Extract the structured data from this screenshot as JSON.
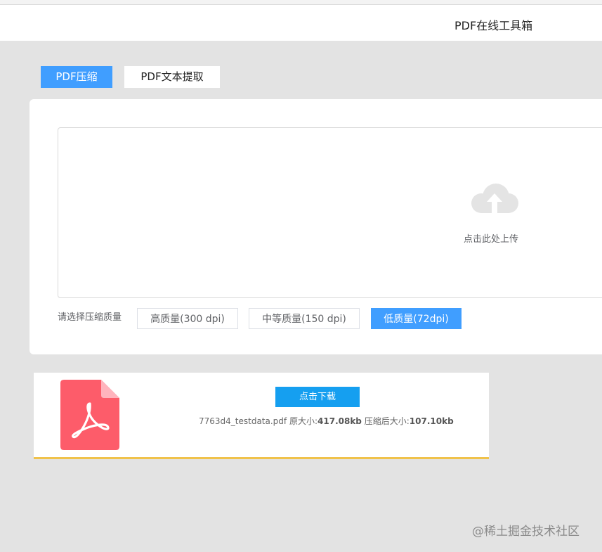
{
  "header": {
    "title": "PDF在线工具箱"
  },
  "tabs": [
    {
      "label": "PDF压缩",
      "active": true
    },
    {
      "label": "PDF文本提取",
      "active": false
    }
  ],
  "upload": {
    "icon": "cloud-upload-icon",
    "label": "点击此处上传"
  },
  "quality": {
    "label": "请选择压缩质量",
    "options": [
      "高质量(300 dpi)",
      "中等质量(150 dpi)",
      "低质量(72dpi)"
    ],
    "selected": "低质量(72dpi)"
  },
  "result": {
    "icon": "pdf-file-icon",
    "download_label": "点击下载",
    "filename": "7763d4_testdata.pdf",
    "original_size_label": "原大小:",
    "original_size": "417.08kb",
    "compressed_size_label": "压缩后大小:",
    "compressed_size": "107.10kb"
  },
  "watermark": "@稀土掘金技术社区",
  "colors": {
    "accent": "#409eff",
    "download": "#159ff0",
    "pdf_icon": "#fd5c6a",
    "result_border": "#f0c24b"
  }
}
